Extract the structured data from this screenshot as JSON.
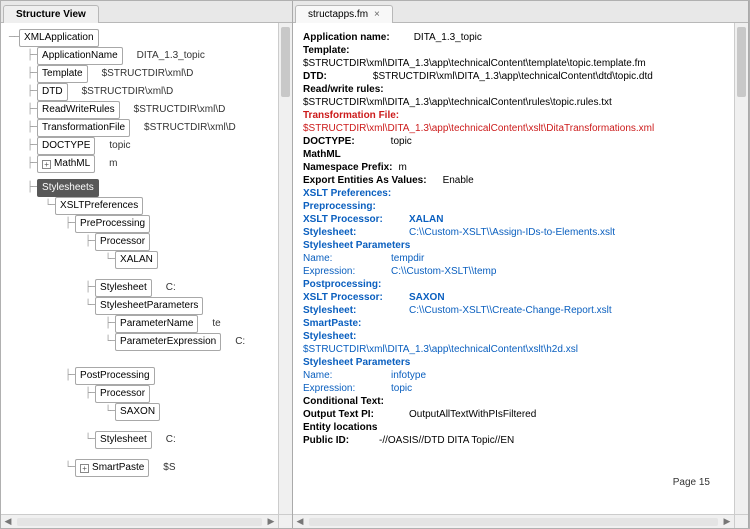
{
  "tabs": {
    "leftTitle": "Structure View",
    "rightTitle": "structapps.fm",
    "close": "×"
  },
  "tree": {
    "xmlApp": "XMLApplication",
    "appName": "ApplicationName",
    "appNameVal": "DITA_1.3_topic",
    "template": "Template",
    "templateVal": "$STRUCTDIR\\xml\\D",
    "dtd": "DTD",
    "dtdVal": "$STRUCTDIR\\xml\\D",
    "rwRules": "ReadWriteRules",
    "rwRulesVal": "$STRUCTDIR\\xml\\D",
    "transFile": "TransformationFile",
    "transFileVal": "$STRUCTDIR\\xml\\D",
    "doctype": "DOCTYPE",
    "doctypeVal": "topic",
    "mathml": "MathML",
    "mathmlVal": "m",
    "stylesheets": "Stylesheets",
    "xsltPrefs": "XSLTPreferences",
    "preProc": "PreProcessing",
    "processor": "Processor",
    "xalan": "XALAN",
    "stylesheet": "Stylesheet",
    "stylesheetVal": "C:",
    "styleParams": "StylesheetParameters",
    "paramName": "ParameterName",
    "paramNameVal": "te",
    "paramExpr": "ParameterExpression",
    "paramExprVal": "C:",
    "postProc": "PostProcessing",
    "saxon": "SAXON",
    "smartPaste": "SmartPaste",
    "smartPasteVal": "$S",
    "plus": "+",
    "minus": "−"
  },
  "doc": {
    "appNameLbl": "Application name:",
    "appNameVal": "DITA_1.3_topic",
    "templateLbl": "Template:",
    "templateVal": "$STRUCTDIR\\xml\\DITA_1.3\\app\\technicalContent\\template\\topic.template.fm",
    "dtdLbl": "DTD:",
    "dtdVal": "$STRUCTDIR\\xml\\DITA_1.3\\app\\technicalContent\\dtd\\topic.dtd",
    "rwLbl": "Read/write rules:",
    "rwVal": "$STRUCTDIR\\xml\\DITA_1.3\\app\\technicalContent\\rules\\topic.rules.txt",
    "transLbl": "Transformation File:",
    "transVal": "$STRUCTDIR\\xml\\DITA_1.3\\app\\technicalContent\\xslt\\DitaTransformations.xml",
    "doctypeLbl": "DOCTYPE:",
    "doctypeVal": "topic",
    "mathml": "MathML",
    "nsPrefixLbl": "Namespace Prefix:",
    "nsPrefixVal": "m",
    "exportEntLbl": "Export Entities As Values:",
    "exportEntVal": "Enable",
    "xsltPrefs": "XSLT Preferences:",
    "preproc": "Preprocessing:",
    "xsltProcLbl": "XSLT Processor:",
    "xalanVal": "XALAN",
    "styleLbl": "Stylesheet:",
    "styleVal1": "C:\\\\Custom-XSLT\\\\Assign-IDs-to-Elements.xslt",
    "styleParams": "Stylesheet Parameters",
    "nameLbl": "Name:",
    "nameVal1": "tempdir",
    "exprLbl": "Expression:",
    "exprVal1": "C:\\\\Custom-XSLT\\\\temp",
    "postproc": "Postprocessing:",
    "saxonVal": "SAXON",
    "styleVal2": "C:\\\\Custom-XSLT\\\\Create-Change-Report.xslt",
    "smartPaste": "SmartPaste:",
    "spStyleVal": "$STRUCTDIR\\xml\\DITA_1.3\\app\\technicalContent\\xslt\\h2d.xsl",
    "nameVal2": "infotype",
    "exprVal2": "topic",
    "condText": "Conditional Text:",
    "outPiLbl": "Output Text PI:",
    "outPiVal": "OutputAllTextWithPIsFiltered",
    "entLoc": "Entity locations",
    "pubIdLbl": "Public ID:",
    "pubIdVal": "-//OASIS//DTD DITA Topic//EN",
    "page": "Page 15"
  }
}
